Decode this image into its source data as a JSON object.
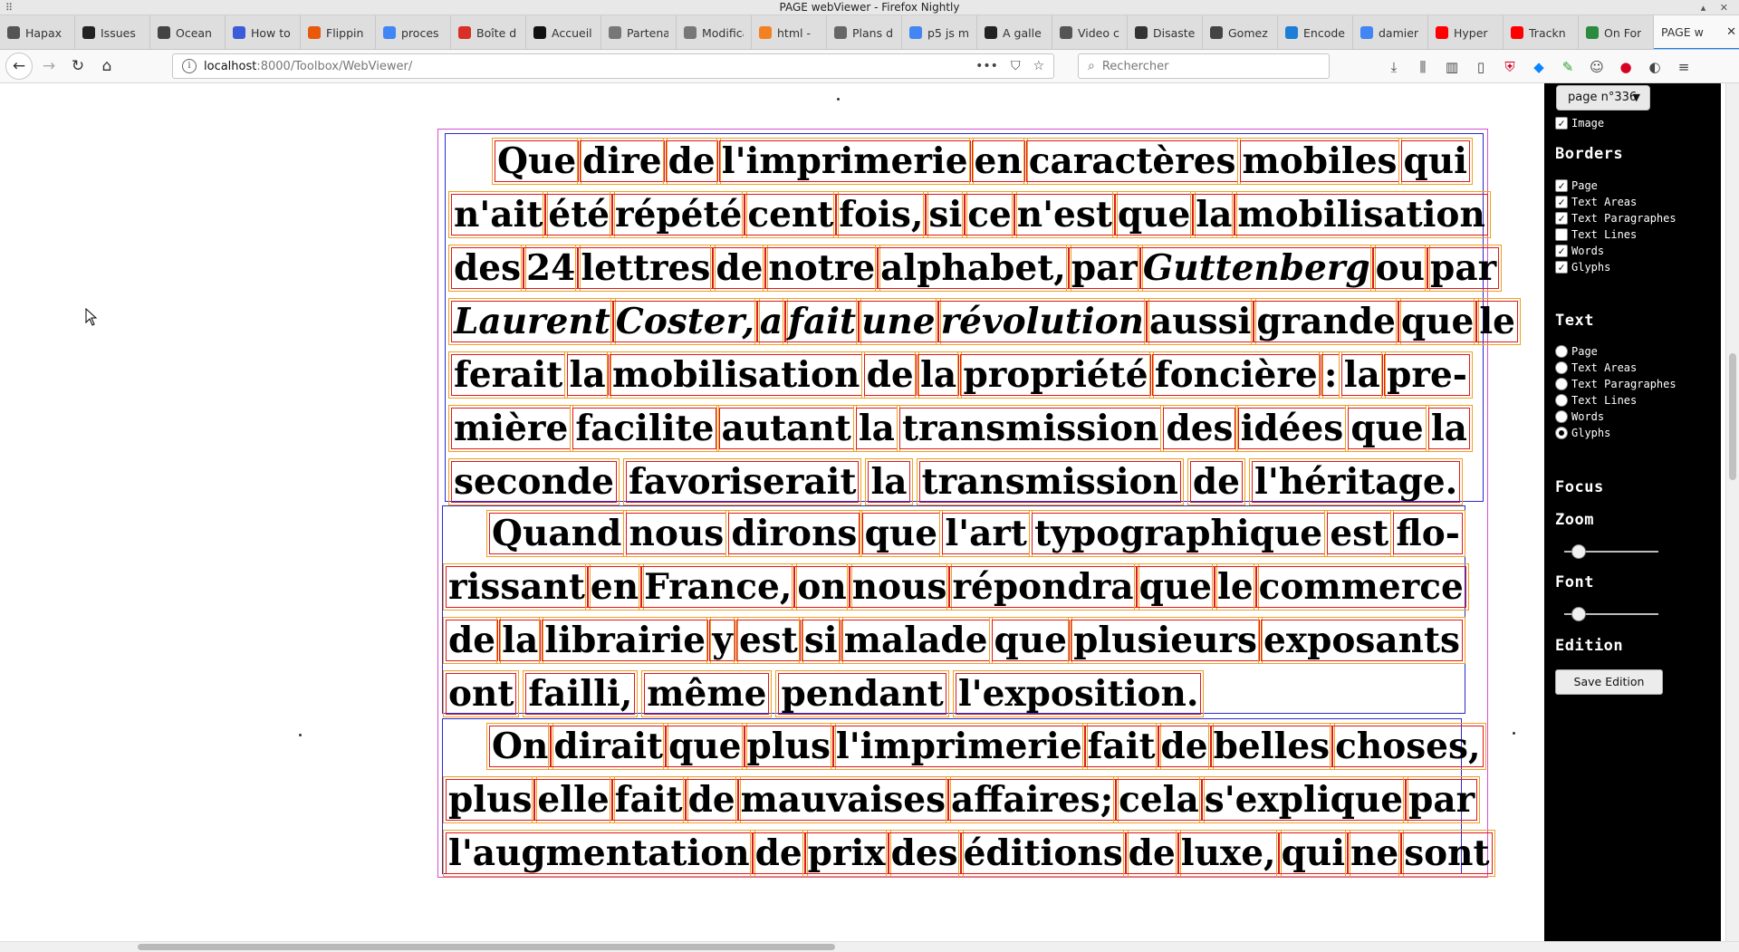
{
  "window": {
    "title": "PAGE webViewer - Firefox Nightly"
  },
  "tabs": [
    {
      "label": "Hapax",
      "color": "#555"
    },
    {
      "label": "Issues",
      "color": "#222"
    },
    {
      "label": "Ocean",
      "color": "#444"
    },
    {
      "label": "How to",
      "color": "#3b5bdb"
    },
    {
      "label": "Flippin",
      "color": "#e8590c"
    },
    {
      "label": "proces",
      "color": "#4285f4"
    },
    {
      "label": "Boîte d",
      "color": "#d93025"
    },
    {
      "label": "Accueil",
      "color": "#111"
    },
    {
      "label": "Partenaire",
      "color": "#777"
    },
    {
      "label": "Modificatio",
      "color": "#777"
    },
    {
      "label": "html -",
      "color": "#f48024"
    },
    {
      "label": "Plans d",
      "color": "#666"
    },
    {
      "label": "p5 js m",
      "color": "#4285f4"
    },
    {
      "label": "A galle",
      "color": "#222"
    },
    {
      "label": "Video c",
      "color": "#555"
    },
    {
      "label": "Disaste",
      "color": "#333"
    },
    {
      "label": "Gomez",
      "color": "#444"
    },
    {
      "label": "Encode",
      "color": "#1c7ed6"
    },
    {
      "label": "damier",
      "color": "#4285f4"
    },
    {
      "label": "Hyper",
      "color": "#ff0000"
    },
    {
      "label": "Trackn",
      "color": "#ff0000"
    },
    {
      "label": "On For",
      "color": "#2b8a3e"
    }
  ],
  "active_tab": {
    "label": "PAGE w",
    "close": "✕"
  },
  "new_tab": "+",
  "nav": {
    "url_host": "localhost",
    "url_path": ":8000/Toolbox/WebViewer/",
    "search_placeholder": "Rechercher"
  },
  "document": {
    "paragraphs": [
      {
        "lines": [
          {
            "indent": true,
            "words": [
              "Que",
              "dire",
              "de",
              "l'imprimerie",
              "en",
              "caractères",
              "mobiles",
              "qui"
            ]
          },
          {
            "words": [
              "n'ait",
              "été",
              "répété",
              "cent",
              "fois,",
              "si",
              "ce",
              "n'est",
              "que",
              "la",
              "mobilisation"
            ]
          },
          {
            "words": [
              "des",
              "24",
              "lettres",
              "de",
              "notre",
              "alphabet,",
              "par",
              "Guttenberg",
              "ou",
              "par"
            ],
            "italic": [
              7
            ]
          },
          {
            "words": [
              "Laurent",
              "Coster,",
              "a",
              "fait",
              "une",
              "révolution",
              "aussi",
              "grande",
              "que",
              "le"
            ],
            "italic": [
              0,
              1,
              2,
              3,
              4,
              5
            ]
          },
          {
            "words": [
              "ferait",
              "la",
              "mobilisation",
              "de",
              "la",
              "propriété",
              "foncière",
              ":",
              "la",
              "pre-"
            ]
          },
          {
            "words": [
              "mière",
              "facilite",
              "autant",
              "la",
              "transmission",
              "des",
              "idées",
              "que",
              "la"
            ]
          },
          {
            "last": true,
            "words": [
              "seconde",
              "favoriserait",
              "la",
              "transmission",
              "de",
              "l'héritage."
            ]
          }
        ]
      },
      {
        "lines": [
          {
            "indent": true,
            "words": [
              "Quand",
              "nous",
              "dirons",
              "que",
              "l'art",
              "typographique",
              "est",
              "flo-"
            ]
          },
          {
            "words": [
              "rissant",
              "en",
              "France,",
              "on",
              "nous",
              "répondra",
              "que",
              "le",
              "commerce"
            ]
          },
          {
            "words": [
              "de",
              "la",
              "librairie",
              "y",
              "est",
              "si",
              "malade",
              "que",
              "plusieurs",
              "exposants"
            ]
          },
          {
            "last": true,
            "words": [
              "ont",
              "failli,",
              "même",
              "pendant",
              "l'exposition."
            ]
          }
        ]
      },
      {
        "lines": [
          {
            "indent": true,
            "words": [
              "On",
              "dirait",
              "que",
              "plus",
              "l'imprimerie",
              "fait",
              "de",
              "belles",
              "choses,"
            ]
          },
          {
            "words": [
              "plus",
              "elle",
              "fait",
              "de",
              "mauvaises",
              "affaires;",
              "cela",
              "s'explique",
              "par"
            ]
          },
          {
            "words": [
              "l'augmentation",
              "de",
              "prix",
              "des",
              "éditions",
              "de",
              "luxe,",
              "qui",
              "ne",
              "sont"
            ]
          }
        ]
      }
    ]
  },
  "panel": {
    "page_select": "page n°336",
    "image_label": "Image",
    "borders_title": "Borders",
    "borders": [
      {
        "label": "Page",
        "checked": true
      },
      {
        "label": "Text Areas",
        "checked": true
      },
      {
        "label": "Text Paragraphes",
        "checked": true
      },
      {
        "label": "Text Lines",
        "checked": false
      },
      {
        "label": "Words",
        "checked": true
      },
      {
        "label": "Glyphs",
        "checked": true
      }
    ],
    "text_title": "Text",
    "text_options": [
      {
        "label": "Page",
        "selected": false
      },
      {
        "label": "Text Areas",
        "selected": false
      },
      {
        "label": "Text Paragraphes",
        "selected": false
      },
      {
        "label": "Text Lines",
        "selected": false
      },
      {
        "label": "Words",
        "selected": false
      },
      {
        "label": "Glyphs",
        "selected": true
      }
    ],
    "focus_title": "Focus",
    "zoom_title": "Zoom",
    "zoom_value": 0.15,
    "font_title": "Font",
    "font_value": 0.15,
    "edition_title": "Edition",
    "save_label": "Save Edition"
  }
}
